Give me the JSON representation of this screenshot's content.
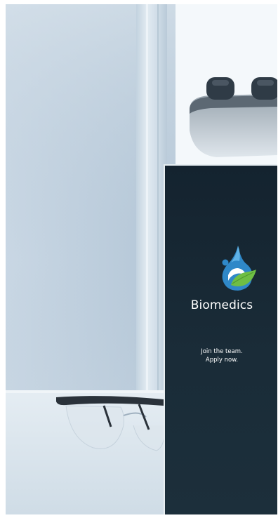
{
  "brand": {
    "name": "Biomedics",
    "tagline_line1": "Join the team.",
    "tagline_line2": "Apply now."
  },
  "colors": {
    "panel": "#182a36",
    "logo_blue": "#2f88c8",
    "logo_green": "#6fbe44",
    "text": "#ffffff"
  },
  "icons": {
    "logo": "droplet-leaf-logo"
  }
}
